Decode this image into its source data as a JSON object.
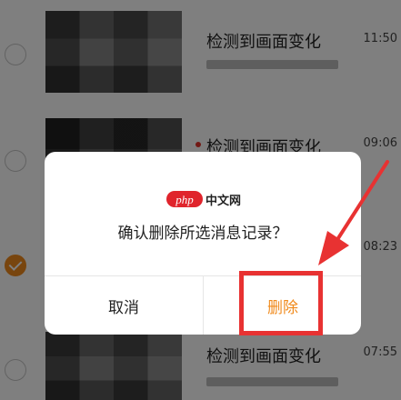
{
  "messages": [
    {
      "title": "检测到画面变化",
      "time": "11:50",
      "selected": false,
      "unread": false
    },
    {
      "title": "检测到画面变化",
      "time": "09:06",
      "selected": false,
      "unread": true
    },
    {
      "title": "",
      "time": "08:23",
      "selected": true,
      "unread": false
    },
    {
      "title": "检测到画面变化",
      "time": "07:55",
      "selected": false,
      "unread": false
    }
  ],
  "dialog": {
    "brand_badge": "php",
    "brand_text": "中文网",
    "message": "确认删除所选消息记录？",
    "cancel_label": "取消",
    "delete_label": "删除"
  },
  "colors": {
    "accent": "#f08a1c",
    "annotation": "#e83232",
    "unread_dot": "#e5332a"
  }
}
